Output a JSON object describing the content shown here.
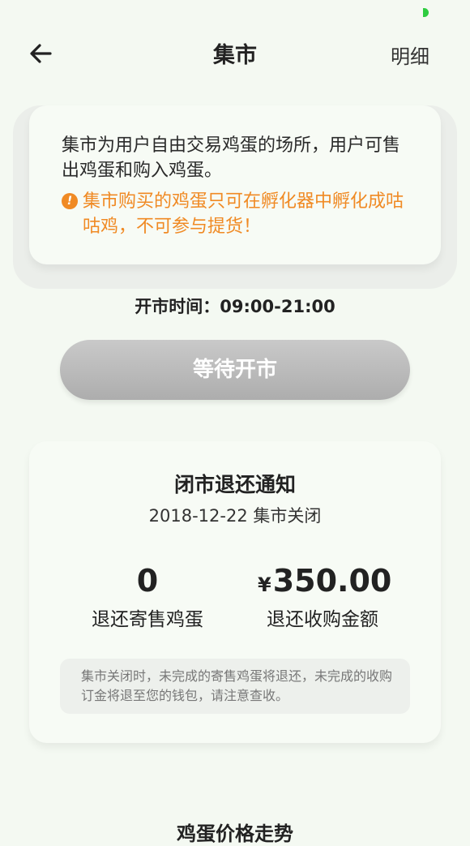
{
  "header": {
    "title": "集市",
    "detail_label": "明细"
  },
  "intro": {
    "text": "集市为用户自由交易鸡蛋的场所，用户可售出鸡蛋和购入鸡蛋。",
    "warning_icon": "!",
    "warning": "集市购买的鸡蛋只可在孵化器中孵化成咕咕鸡，不可参与提货！"
  },
  "market": {
    "open_time": "开市时间：09:00-21:00",
    "wait_button": "等待开市"
  },
  "notice": {
    "title": "闭市退还通知",
    "date": "2018-12-22 集市关闭",
    "eggs_value": "0",
    "eggs_label": "退还寄售鸡蛋",
    "currency": "¥",
    "amount_value": "350.00",
    "amount_label": "退还收购金额",
    "tip": "集市关闭时，未完成的寄售鸡蛋将退还，未完成的收购订金将退至您的钱包，请注意查收。"
  },
  "trend": {
    "title": "鸡蛋价格走势"
  },
  "colors": {
    "background": "#f4f9f2",
    "warning": "#f08a24",
    "button_disabled": "#b8b8b8",
    "status": "#2ecc40"
  },
  "icons": {
    "back": "back-arrow-icon",
    "warning": "exclamation-circle-icon"
  }
}
